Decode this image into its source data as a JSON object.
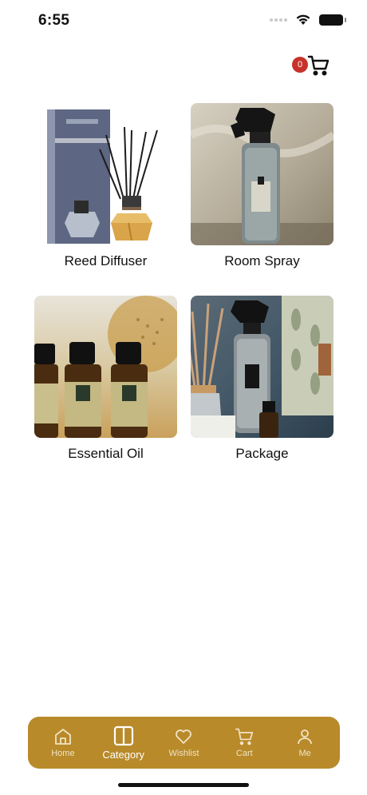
{
  "status": {
    "time": "6:55"
  },
  "header": {
    "cart_count": "0",
    "cart_icon": "cart-icon",
    "badge_color": "#c8322b"
  },
  "categories": [
    {
      "label": "Reed Diffuser",
      "image": "reed-diffuser-image"
    },
    {
      "label": "Room Spray",
      "image": "room-spray-image"
    },
    {
      "label": "Essential Oil",
      "image": "essential-oil-image"
    },
    {
      "label": "Package",
      "image": "package-image"
    }
  ],
  "nav": {
    "bg_color": "#b88a2a",
    "items": [
      {
        "label": "Home",
        "icon": "home-icon",
        "active": false
      },
      {
        "label": "Category",
        "icon": "category-icon",
        "active": true
      },
      {
        "label": "Wishlist",
        "icon": "heart-icon",
        "active": false
      },
      {
        "label": "Cart",
        "icon": "cart-icon",
        "active": false
      },
      {
        "label": "Me",
        "icon": "user-icon",
        "active": false
      }
    ]
  }
}
